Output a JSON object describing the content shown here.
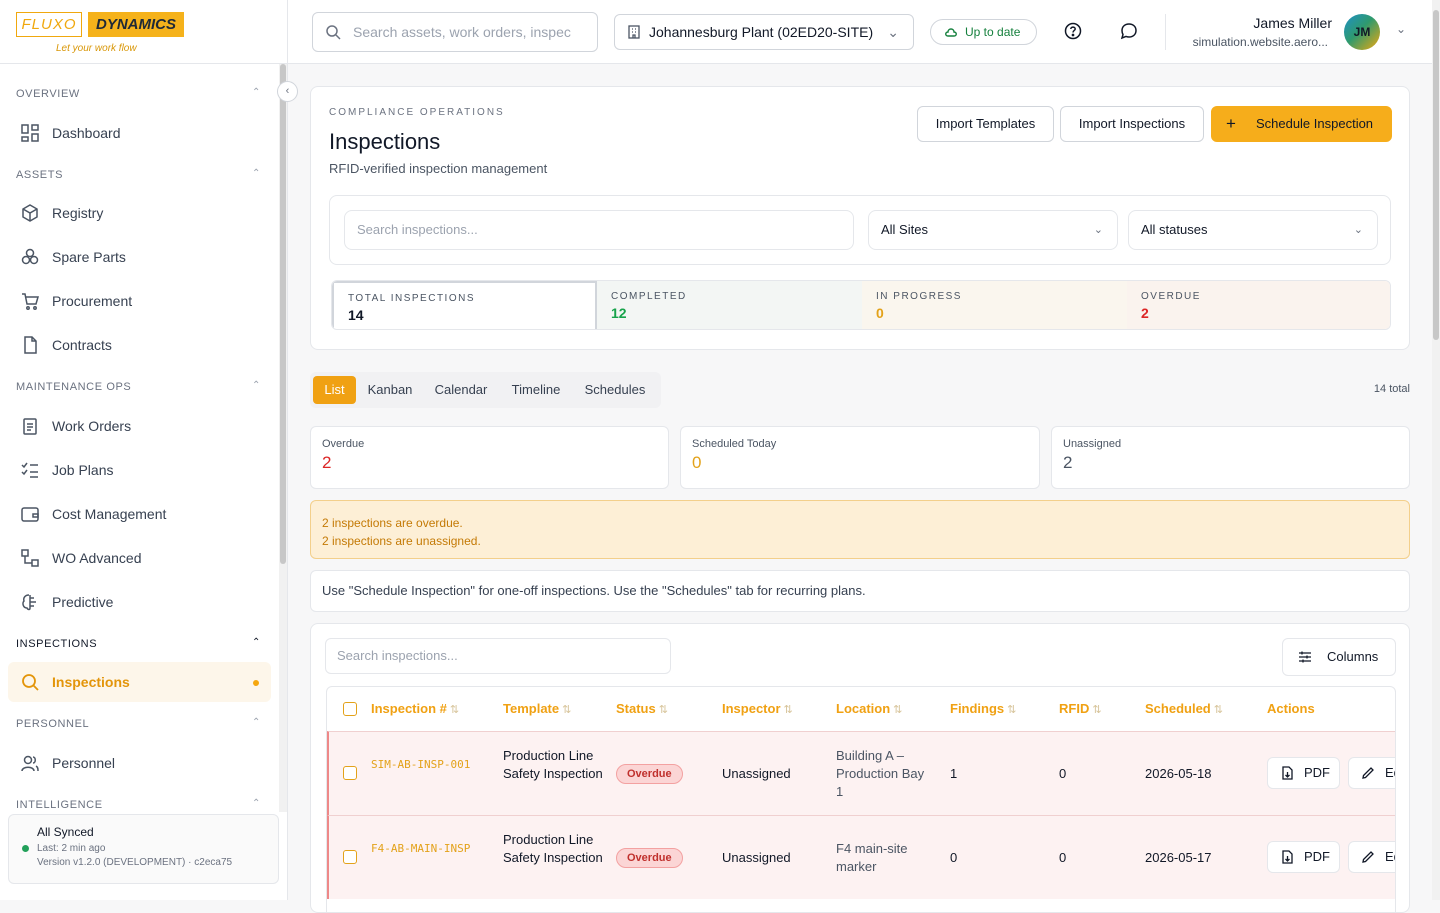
{
  "brand": {
    "name_left": "FLUXO",
    "name_right": "DYNAMICS",
    "tagline": "Let your work flow"
  },
  "sidebar": {
    "sections": [
      {
        "label": "OVERVIEW",
        "items": [
          {
            "label": "Dashboard",
            "icon": "dashboard-icon"
          }
        ]
      },
      {
        "label": "ASSETS",
        "items": [
          {
            "label": "Registry",
            "icon": "box-icon"
          },
          {
            "label": "Spare Parts",
            "icon": "parts-icon"
          },
          {
            "label": "Procurement",
            "icon": "cart-icon"
          },
          {
            "label": "Contracts",
            "icon": "file-icon"
          }
        ]
      },
      {
        "label": "MAINTENANCE OPS",
        "items": [
          {
            "label": "Work Orders",
            "icon": "clipboard-icon"
          },
          {
            "label": "Job Plans",
            "icon": "checklist-icon"
          },
          {
            "label": "Cost Management",
            "icon": "wallet-icon"
          },
          {
            "label": "WO Advanced",
            "icon": "workflow-icon"
          },
          {
            "label": "Predictive",
            "icon": "brain-icon"
          }
        ]
      },
      {
        "label": "INSPECTIONS",
        "items": [
          {
            "label": "Inspections",
            "icon": "search-icon",
            "active": true
          }
        ]
      },
      {
        "label": "PERSONNEL",
        "items": [
          {
            "label": "Personnel",
            "icon": "users-icon"
          }
        ]
      },
      {
        "label": "INTELLIGENCE",
        "items": []
      }
    ],
    "sync": {
      "title": "All Synced",
      "last": "Last: 2 min ago",
      "version": "Version v1.2.0 (DEVELOPMENT) · c2eca75"
    }
  },
  "topbar": {
    "search_placeholder": "Search assets, work orders, inspec",
    "site": "Johannesburg Plant (02ED20-SITE)",
    "sync_status": "Up to date",
    "user_name": "James Miller",
    "user_email": "simulation.website.aero...",
    "user_initials": "JM"
  },
  "header": {
    "eyebrow": "COMPLIANCE OPERATIONS",
    "title": "Inspections",
    "subtitle": "RFID-verified inspection management",
    "btn_import_templates": "Import Templates",
    "btn_import_inspections": "Import Inspections",
    "btn_schedule": "Schedule Inspection"
  },
  "filters": {
    "search_placeholder": "Search inspections...",
    "site": "All Sites",
    "status": "All statuses"
  },
  "stats": [
    {
      "label": "TOTAL INSPECTIONS",
      "value": "14",
      "color": "#111827"
    },
    {
      "label": "COMPLETED",
      "value": "12",
      "color": "#16a34a"
    },
    {
      "label": "IN PROGRESS",
      "value": "0",
      "color": "#e3a21a"
    },
    {
      "label": "OVERDUE",
      "value": "2",
      "color": "#dc2626"
    }
  ],
  "views": {
    "tabs": [
      "List",
      "Kanban",
      "Calendar",
      "Timeline",
      "Schedules"
    ],
    "active": "List",
    "total": "14 total"
  },
  "summary": [
    {
      "label": "Overdue",
      "value": "2",
      "color": "#dc2626"
    },
    {
      "label": "Scheduled Today",
      "value": "0",
      "color": "#e3a21a"
    },
    {
      "label": "Unassigned",
      "value": "2",
      "color": "#4b5563"
    }
  ],
  "alerts": [
    "2 inspections are overdue.",
    "2 inspections are unassigned."
  ],
  "note": "Use \"Schedule Inspection\" for one-off inspections. Use the \"Schedules\" tab for recurring plans.",
  "table": {
    "search_placeholder": "Search inspections...",
    "columns_button": "Columns",
    "headers": [
      "Inspection #",
      "Template",
      "Status",
      "Inspector",
      "Location",
      "Findings",
      "RFID",
      "Scheduled",
      "Actions"
    ],
    "rows": [
      {
        "id": "SIM-AB-INSP-001",
        "template": "Production Line Safety Inspection",
        "status": "Overdue",
        "inspector": "Unassigned",
        "location": "Building A – Production Bay 1",
        "findings": "1",
        "rfid": "0",
        "scheduled": "2026-05-18"
      },
      {
        "id": "F4-AB-MAIN-INSP",
        "template": "Production Line Safety Inspection",
        "status": "Overdue",
        "inspector": "Unassigned",
        "location": "F4 main-site marker",
        "findings": "0",
        "rfid": "0",
        "scheduled": "2026-05-17"
      }
    ],
    "action_pdf": "PDF",
    "action_edit": "Edit"
  }
}
